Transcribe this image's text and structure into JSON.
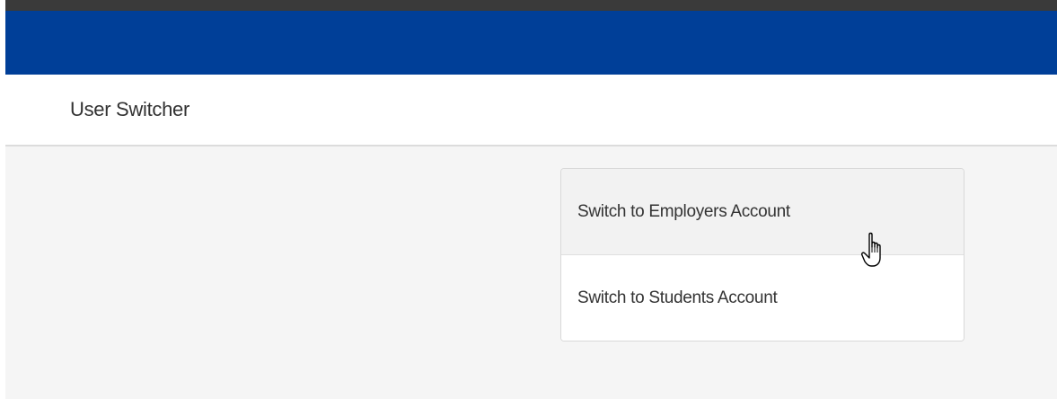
{
  "header": {
    "title": "User Switcher"
  },
  "switcher": {
    "items": [
      {
        "label": "Switch to Employers Account"
      },
      {
        "label": "Switch to Students Account"
      }
    ]
  },
  "colors": {
    "navbar": "#003f98",
    "top_strip": "#3a3a3a",
    "content_bg": "#f5f5f5"
  },
  "icons": {
    "cursor": "hand-pointer-cursor-icon"
  }
}
